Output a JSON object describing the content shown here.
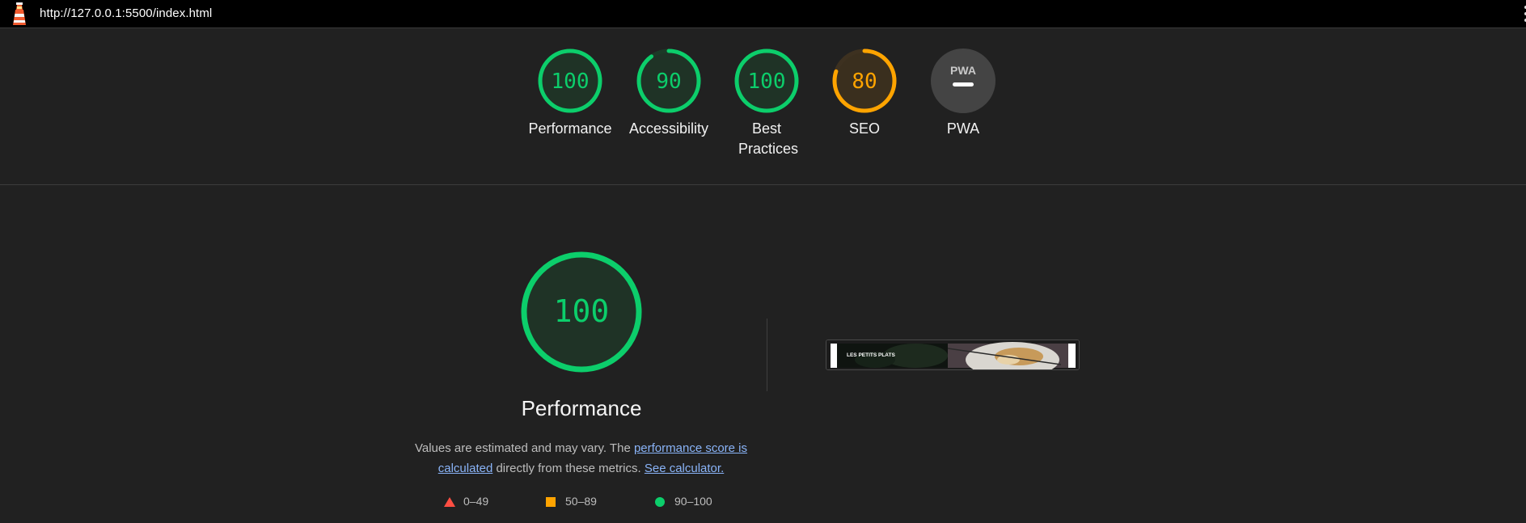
{
  "browser": {
    "url": "http://127.0.0.1:5500/index.html",
    "logo_icon": "lighthouse-icon",
    "menu_icon": "more-vert-icon"
  },
  "colors": {
    "pass": "#0cce6b",
    "average": "#ffa400",
    "fail": "#ff4e42",
    "neutral": "#444444"
  },
  "categories": [
    {
      "id": "performance",
      "score": "100",
      "label": "Performance",
      "fraction": 1.0,
      "status": "pass"
    },
    {
      "id": "accessibility",
      "score": "90",
      "label": "Accessibility",
      "fraction": 0.9,
      "status": "pass"
    },
    {
      "id": "best-practices",
      "score": "100",
      "label": "Best Practices",
      "fraction": 1.0,
      "status": "pass"
    },
    {
      "id": "seo",
      "score": "80",
      "label": "SEO",
      "fraction": 0.8,
      "status": "average"
    },
    {
      "id": "pwa",
      "score": "",
      "label": "PWA",
      "badge_text": "PWA",
      "status": "neutral"
    }
  ],
  "main": {
    "score": "100",
    "title": "Performance",
    "desc_prefix": "Values are estimated and may vary. The ",
    "link_score": "performance score is calculated",
    "desc_middle": " directly from these metrics. ",
    "link_calculator": "See calculator."
  },
  "legend": [
    {
      "icon": "triangle-fail-icon",
      "text": "0–49"
    },
    {
      "icon": "square-average-icon",
      "text": "50–89"
    },
    {
      "icon": "circle-pass-icon",
      "text": "90–100"
    }
  ],
  "screenshot": {
    "site_name": "LES PETITS PLATS",
    "alt": "final-screenshot"
  }
}
